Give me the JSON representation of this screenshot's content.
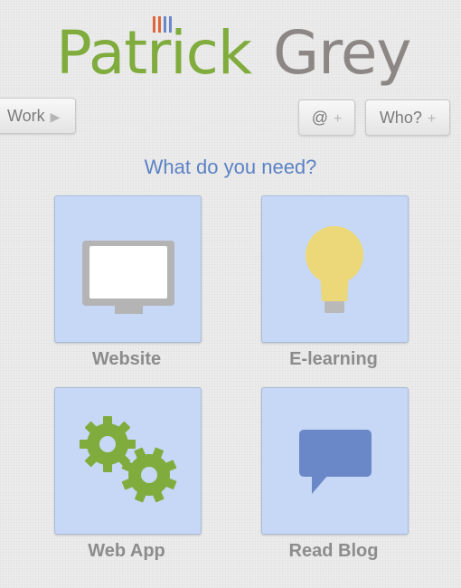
{
  "logo": {
    "first_name": "Patrick",
    "last_name": "Grey",
    "first_color": "#7fac3c",
    "last_color": "#8c8784",
    "bar_colors": [
      "#e0663c",
      "#e0663c",
      "#6a88c8",
      "#6a88c8"
    ]
  },
  "nav": {
    "work_label": "Work",
    "work_icon": "play-arrow-icon",
    "contact_label": "@",
    "about_label": "Who?",
    "plus_glyph": "+"
  },
  "tagline": "What do you need?",
  "tiles": [
    {
      "label": "Website",
      "icon": "monitor-icon"
    },
    {
      "label": "E-learning",
      "icon": "lightbulb-icon"
    },
    {
      "label": "Web App",
      "icon": "gears-icon"
    },
    {
      "label": "Read Blog",
      "icon": "speech-bubble-icon"
    }
  ],
  "colors": {
    "tile_bg": "#c6d8f5",
    "tagline": "#5c82c4",
    "label": "#8c8c8c",
    "gear": "#7fac3c",
    "bulb": "#ecd878",
    "bubble": "#6a88c8"
  }
}
